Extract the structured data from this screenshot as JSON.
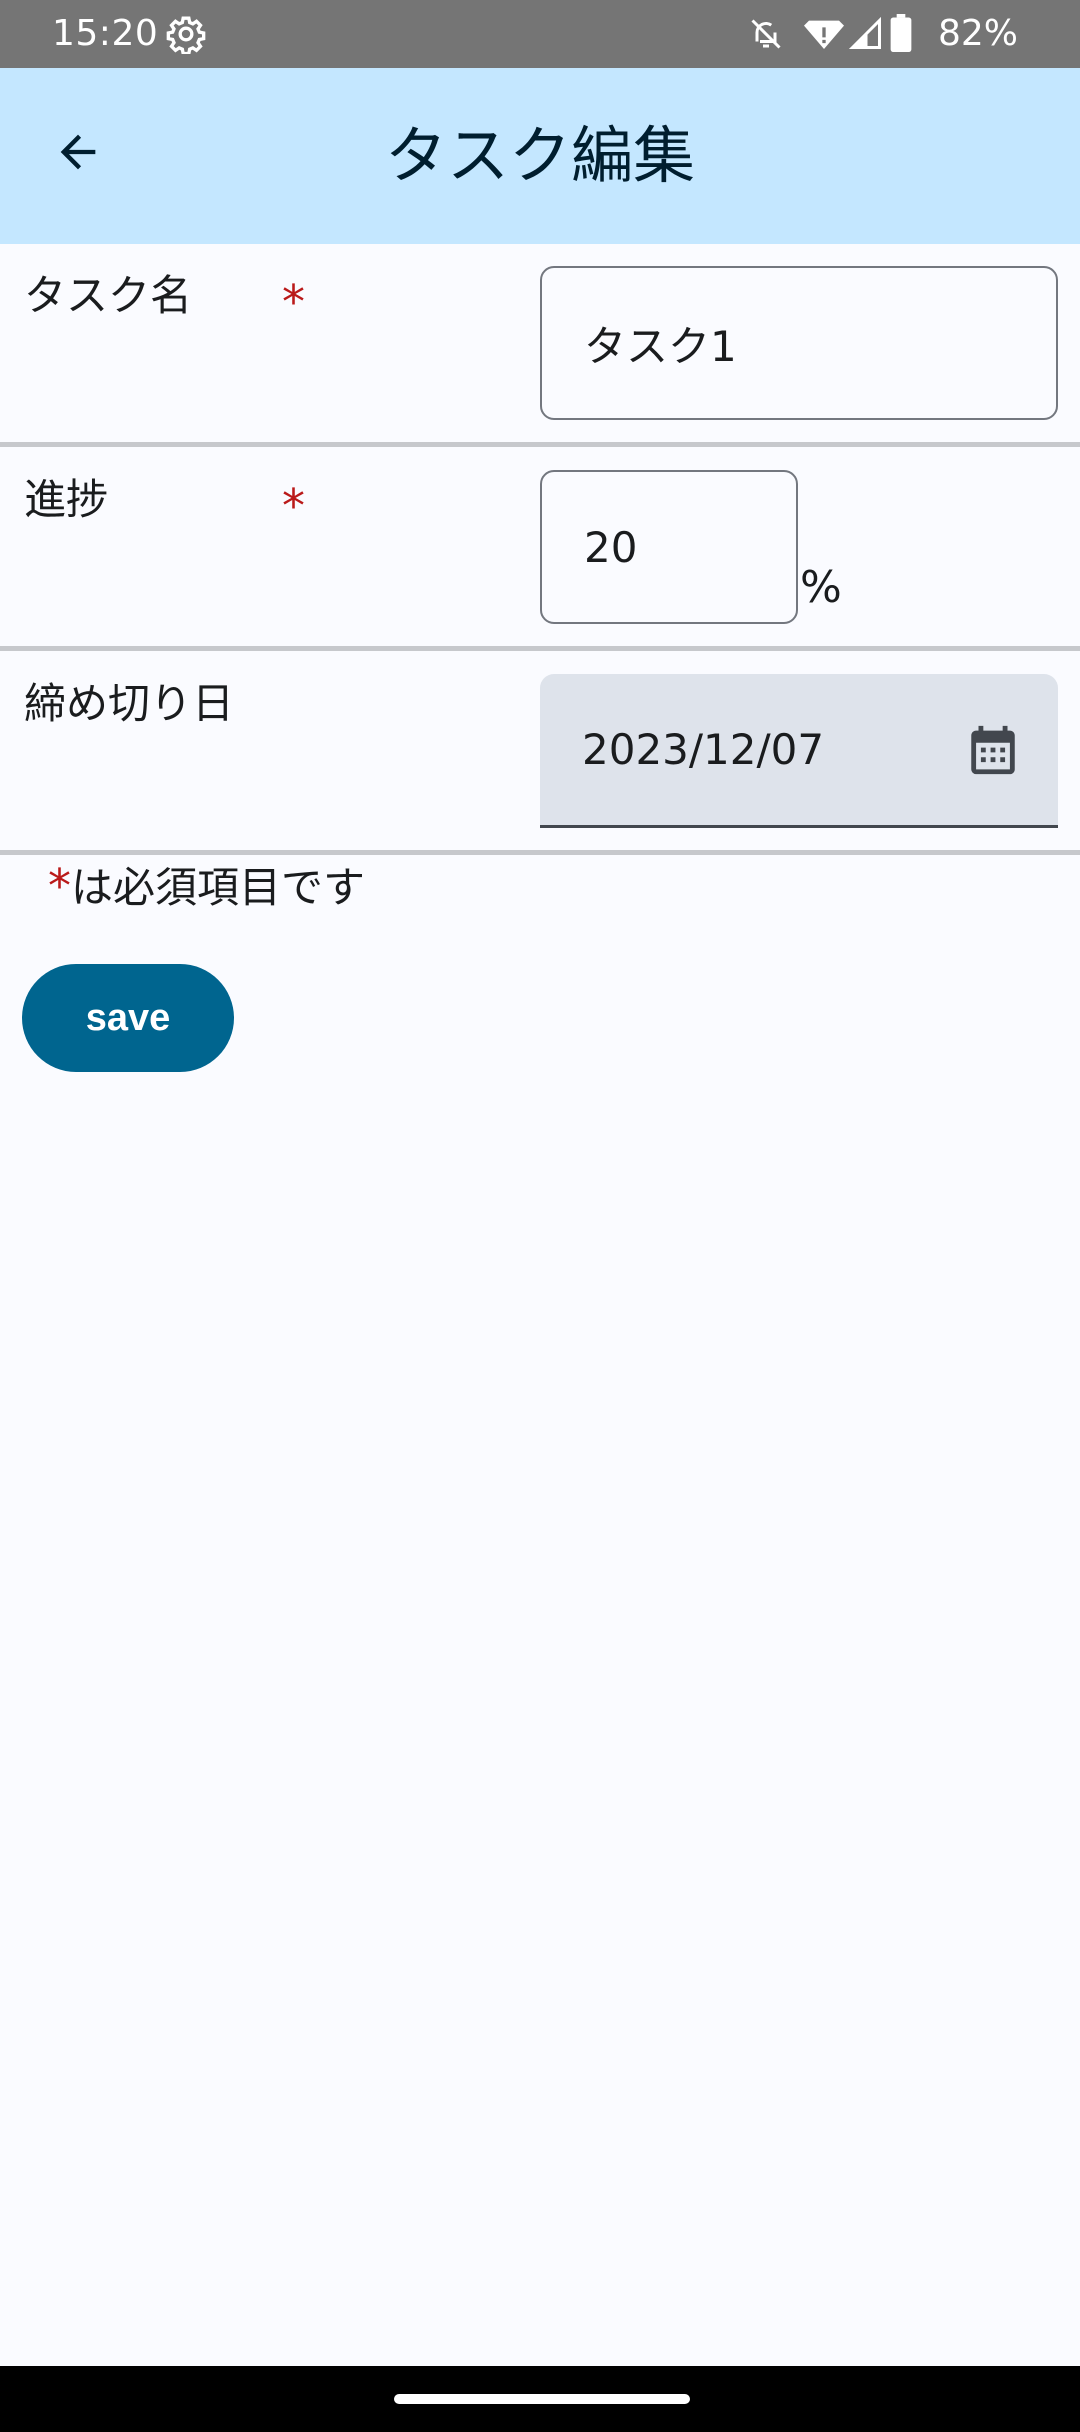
{
  "status_bar": {
    "time": "15:20",
    "battery": "82%",
    "icons": [
      "settings-gear-icon",
      "bell-off-icon",
      "wifi-icon",
      "signal-icon",
      "battery-icon"
    ]
  },
  "app_bar": {
    "title": "タスク編集",
    "back_icon": "arrow-back-icon",
    "color": "#c4e7ff"
  },
  "form": {
    "task_name": {
      "label": "タスク名",
      "required_mark": "*",
      "value": "タスク1"
    },
    "progress": {
      "label": "進捗",
      "required_mark": "*",
      "value": "20",
      "unit": "%"
    },
    "deadline": {
      "label": "締め切り日",
      "value": "2023/12/07",
      "icon": "calendar-icon"
    }
  },
  "required_note": {
    "mark": "*",
    "text": "は必須項目です"
  },
  "save_button": {
    "label": "save",
    "color": "#00658f"
  },
  "colors": {
    "required": "#ba1a1a",
    "background": "#fafbff"
  }
}
